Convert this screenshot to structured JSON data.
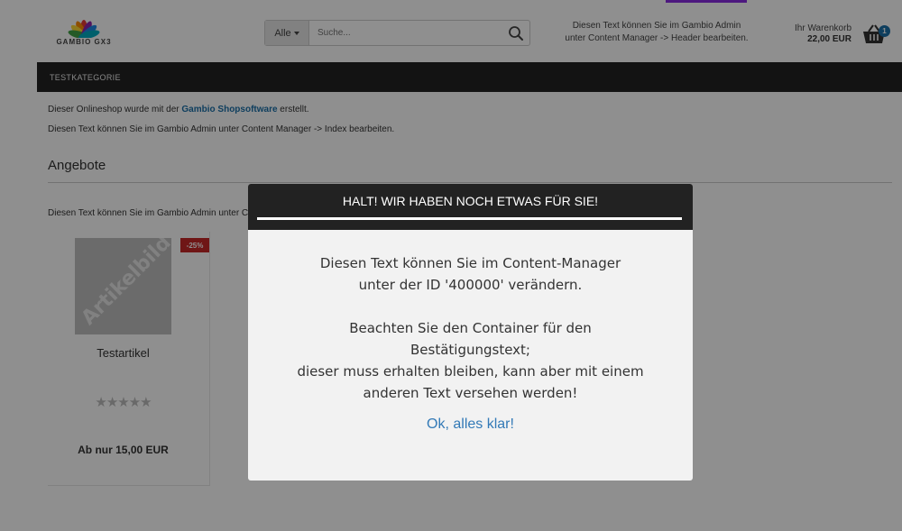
{
  "colors": {
    "accent_top": "#8a2be2",
    "nav_bg": "#222222",
    "link": "#1a6fa8",
    "discount": "#c62828",
    "cart_badge": "#1a6fa8",
    "ok_link": "#337ab7"
  },
  "header": {
    "logo_text": "GAMBIO GX3",
    "search": {
      "category_label": "Alle",
      "placeholder": "Suche..."
    },
    "note_line1": "Diesen Text können Sie im Gambio Admin",
    "note_line2": "unter Content Manager -> Header bearbeiten.",
    "cart": {
      "label": "Ihr Warenkorb",
      "total": "22,00 EUR",
      "count": "1"
    }
  },
  "nav": {
    "items": [
      {
        "label": "TESTKATEGORIE"
      }
    ]
  },
  "main": {
    "intro_prefix": "Dieser Onlineshop wurde mit der ",
    "intro_link": "Gambio Shopsoftware",
    "intro_suffix": " erstellt.",
    "intro_line2": "Diesen Text können Sie im Gambio Admin unter Content Manager -> Index bearbeiten.",
    "section_title": "Angebote",
    "section_note": "Diesen Text können Sie im Gambio Admin unter Content Manager -> Angebote bearbeiten.",
    "product": {
      "image_placeholder": "Artikelbild",
      "discount": "-25%",
      "name": "Testartikel",
      "rating_stars": "★★★★★",
      "price": "Ab nur 15,00 EUR"
    }
  },
  "modal": {
    "title": "HALT! WIR HABEN NOCH ETWAS FÜR SIE!",
    "line1": "Diesen Text können Sie im Content-Manager",
    "line2": "unter der ID '400000' verändern.",
    "line3": "Beachten Sie den Container für den",
    "line4": "Bestätigungstext;",
    "line5": "dieser muss erhalten bleiben, kann aber mit einem",
    "line6": "anderen Text versehen werden!",
    "ok_label": "Ok, alles klar!"
  }
}
